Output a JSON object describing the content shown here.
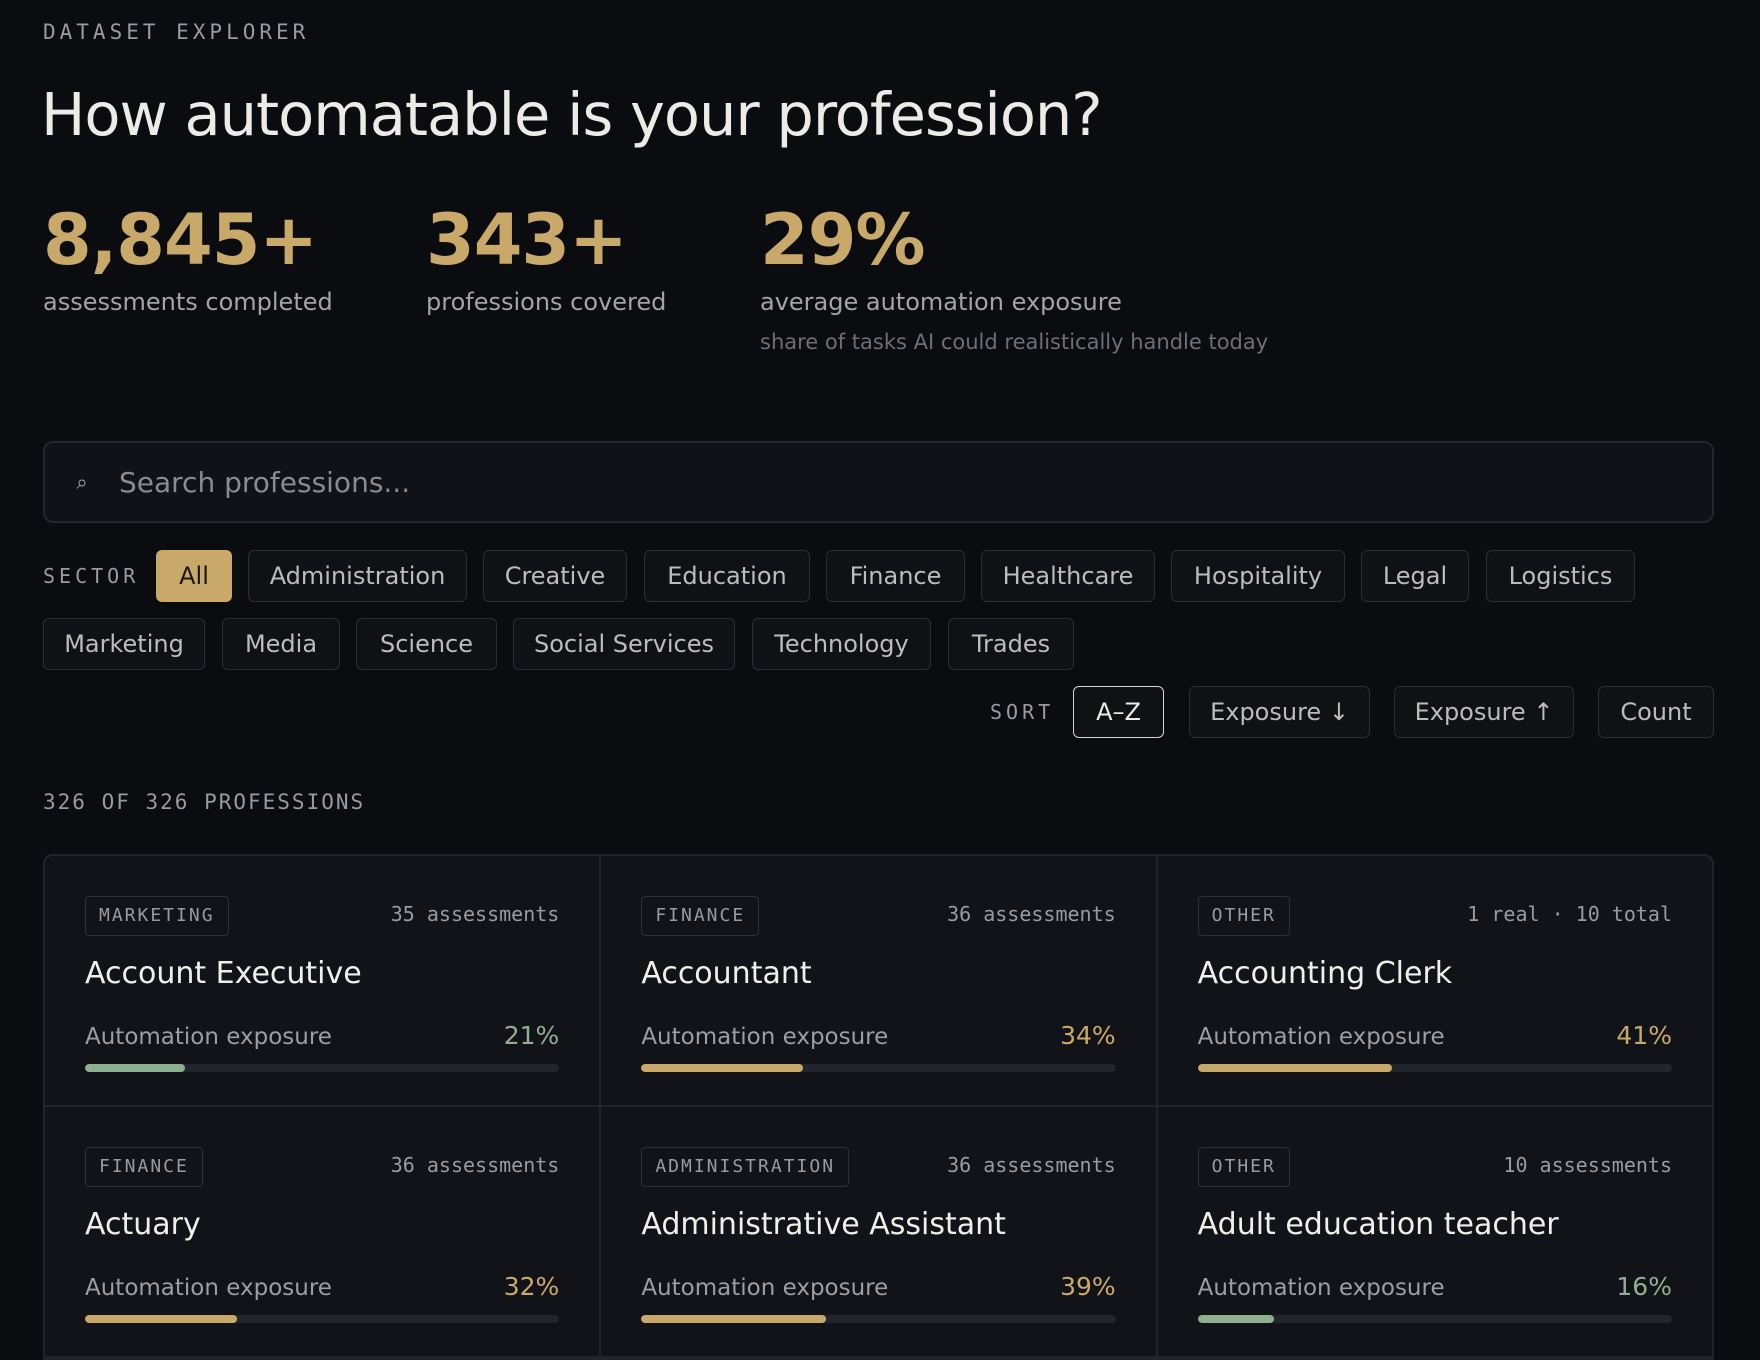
{
  "header": {
    "eyebrow": "DATASET EXPLORER",
    "title": "How automatable is your profession?"
  },
  "stats": [
    {
      "value": "8,845+",
      "label": "assessments completed",
      "sub": ""
    },
    {
      "value": "343+",
      "label": "professions covered",
      "sub": ""
    },
    {
      "value": "29%",
      "label": "average automation exposure",
      "sub": "share of tasks AI could realistically handle today"
    }
  ],
  "search": {
    "icon": "search-icon",
    "placeholder": "Search professions..."
  },
  "sector": {
    "label": "SECTOR",
    "selected": "All",
    "options": [
      "All",
      "Administration",
      "Creative",
      "Education",
      "Finance",
      "Healthcare",
      "Hospitality",
      "Legal",
      "Logistics",
      "Marketing",
      "Media",
      "Science",
      "Social Services",
      "Technology",
      "Trades"
    ]
  },
  "sort": {
    "label": "SORT",
    "selected": "A–Z",
    "options": [
      "A–Z",
      "Exposure ↓",
      "Exposure ↑",
      "Count"
    ]
  },
  "results": {
    "count_label": "326 OF 326 PROFESSIONS"
  },
  "colors": {
    "accent": "#c9a96a",
    "low": "#8fb08f",
    "medium": "#c9a96a"
  },
  "cards": [
    {
      "tag": "MARKETING",
      "meta": "35 assessments",
      "name": "Account Executive",
      "exposure_label": "Automation exposure",
      "exposure": "21%",
      "level": 21,
      "tone": "low"
    },
    {
      "tag": "FINANCE",
      "meta": "36 assessments",
      "name": "Accountant",
      "exposure_label": "Automation exposure",
      "exposure": "34%",
      "level": 34,
      "tone": "medium"
    },
    {
      "tag": "OTHER",
      "meta": "1 real · 10 total",
      "name": "Accounting Clerk",
      "exposure_label": "Automation exposure",
      "exposure": "41%",
      "level": 41,
      "tone": "medium"
    },
    {
      "tag": "FINANCE",
      "meta": "36 assessments",
      "name": "Actuary",
      "exposure_label": "Automation exposure",
      "exposure": "32%",
      "level": 32,
      "tone": "medium"
    },
    {
      "tag": "ADMINISTRATION",
      "meta": "36 assessments",
      "name": "Administrative Assistant",
      "exposure_label": "Automation exposure",
      "exposure": "39%",
      "level": 39,
      "tone": "medium"
    },
    {
      "tag": "OTHER",
      "meta": "10 assessments",
      "name": "Adult education teacher",
      "exposure_label": "Automation exposure",
      "exposure": "16%",
      "level": 16,
      "tone": "low"
    }
  ]
}
